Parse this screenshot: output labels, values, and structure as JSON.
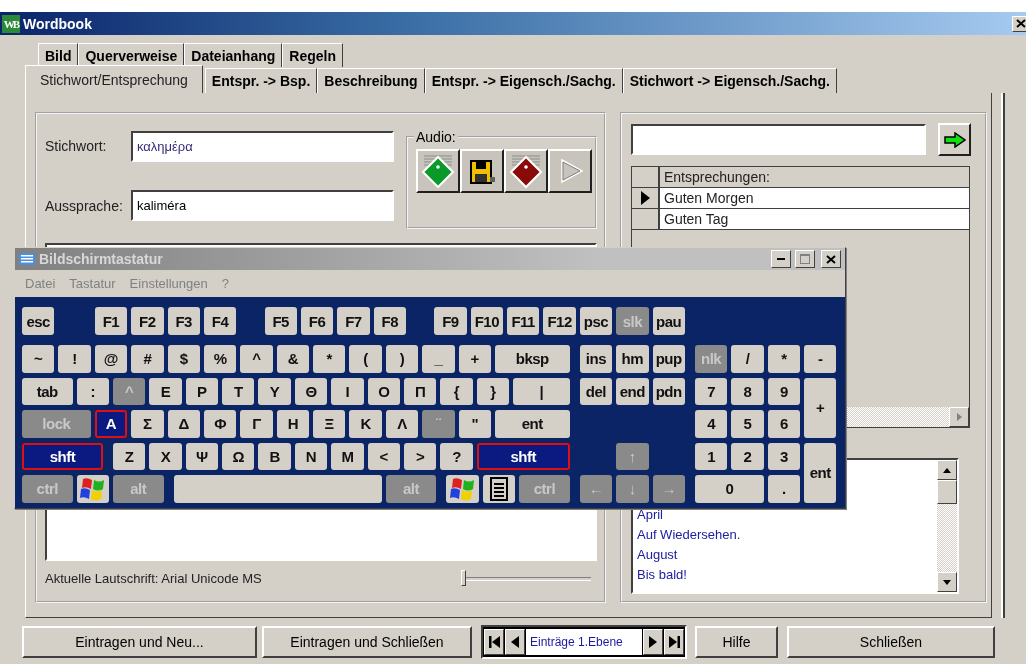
{
  "window": {
    "icon_letters": "WB",
    "title": "Wordbook"
  },
  "tab_rows": [
    [
      {
        "label": "Bild",
        "selected": false
      },
      {
        "label": "Querverweise",
        "selected": false
      },
      {
        "label": "Dateianhang",
        "selected": false
      },
      {
        "label": "Regeln",
        "selected": false
      }
    ],
    [
      {
        "label": "Stichwort/Entsprechung",
        "selected": true
      },
      {
        "label": "Entspr. -> Bsp.",
        "selected": false
      },
      {
        "label": "Beschreibung",
        "selected": false
      },
      {
        "label": "Entspr. -> Eigensch./Sachg.",
        "selected": false
      },
      {
        "label": "Stichwort -> Eigensch./Sachg.",
        "selected": false
      }
    ]
  ],
  "entry": {
    "fields": [
      {
        "label": "Stichwort:",
        "value": "καλημέρα"
      },
      {
        "label": "Aussprache:",
        "value": "kaliméra"
      }
    ],
    "audio": {
      "label": "Audio:",
      "buttons": [
        {
          "kind": "record",
          "disabled": false
        },
        {
          "kind": "save",
          "disabled": false
        },
        {
          "kind": "stop",
          "disabled": false
        },
        {
          "kind": "play",
          "disabled": true
        }
      ]
    },
    "font_label": "Aktuelle Lautschrift: Arial Unicode MS",
    "font_slider": {
      "level": 0
    }
  },
  "translations": {
    "column": "Entsprechungen:",
    "rows": [
      {
        "text": "Guten Morgen",
        "selected": true
      },
      {
        "text": "Guten Tag",
        "selected": false
      }
    ],
    "list": [
      "April",
      "Auf Wiedersehen.",
      "August",
      "Bis bald!"
    ]
  },
  "buttons": [
    "Eintragen und Neu...",
    "Eintragen und Schließen"
  ],
  "navigator": {
    "label": "Einträge 1.Ebene"
  },
  "buttons_right": [
    "Hilfe",
    "Schließen"
  ],
  "keyboard": {
    "title": "Bildschirmtastatur",
    "menu": [
      "Datei",
      "Tastatur",
      "Einstellungen",
      "?"
    ],
    "key_rows": [
      {
        "keys": [
          {
            "kind": "char",
            "label": "esc",
            "disabled": false,
            "pressed": false
          },
          {
            "kind": "char",
            "label": "F1",
            "disabled": false,
            "pressed": false
          },
          {
            "kind": "char",
            "label": "F2",
            "disabled": false,
            "pressed": false
          },
          {
            "kind": "char",
            "label": "F3",
            "disabled": false,
            "pressed": false
          },
          {
            "kind": "char",
            "label": "F4",
            "disabled": false,
            "pressed": false
          },
          {
            "kind": "char",
            "label": "F5",
            "disabled": false,
            "pressed": false
          },
          {
            "kind": "char",
            "label": "F6",
            "disabled": false,
            "pressed": false
          },
          {
            "kind": "char",
            "label": "F7",
            "disabled": false,
            "pressed": false
          },
          {
            "kind": "char",
            "label": "F8",
            "disabled": false,
            "pressed": false
          },
          {
            "kind": "char",
            "label": "F9",
            "disabled": false,
            "pressed": false
          },
          {
            "kind": "char",
            "label": "F10",
            "disabled": false,
            "pressed": false
          },
          {
            "kind": "char",
            "label": "F11",
            "disabled": false,
            "pressed": false
          },
          {
            "kind": "char",
            "label": "F12",
            "disabled": false,
            "pressed": false
          },
          {
            "kind": "char",
            "label": "psc",
            "disabled": false,
            "pressed": false
          },
          {
            "kind": "char",
            "label": "slk",
            "disabled": true,
            "pressed": false
          },
          {
            "kind": "char",
            "label": "pau",
            "disabled": false,
            "pressed": false
          }
        ]
      },
      {
        "keys": [
          {
            "kind": "char",
            "label": "~",
            "disabled": false,
            "pressed": false
          },
          {
            "kind": "char",
            "label": "!",
            "disabled": false,
            "pressed": false
          },
          {
            "kind": "char",
            "label": "@",
            "disabled": false,
            "pressed": false
          },
          {
            "kind": "char",
            "label": "#",
            "disabled": false,
            "pressed": false
          },
          {
            "kind": "char",
            "label": "$",
            "disabled": false,
            "pressed": false
          },
          {
            "kind": "char",
            "label": "%",
            "disabled": false,
            "pressed": false
          },
          {
            "kind": "char",
            "label": "^",
            "disabled": false,
            "pressed": false
          },
          {
            "kind": "char",
            "label": "&",
            "disabled": false,
            "pressed": false
          },
          {
            "kind": "char",
            "label": "*",
            "disabled": false,
            "pressed": false
          },
          {
            "kind": "char",
            "label": "(",
            "disabled": false,
            "pressed": false
          },
          {
            "kind": "char",
            "label": ")",
            "disabled": false,
            "pressed": false
          },
          {
            "kind": "char",
            "label": "_",
            "disabled": false,
            "pressed": false
          },
          {
            "kind": "char",
            "label": "+",
            "disabled": false,
            "pressed": false
          },
          {
            "kind": "char",
            "label": "bksp",
            "disabled": false,
            "pressed": false
          },
          {
            "kind": "char",
            "label": "ins",
            "disabled": false,
            "pressed": false
          },
          {
            "kind": "char",
            "label": "hm",
            "disabled": false,
            "pressed": false
          },
          {
            "kind": "char",
            "label": "pup",
            "disabled": false,
            "pressed": false
          },
          {
            "kind": "char",
            "label": "nlk",
            "disabled": true,
            "pressed": false
          },
          {
            "kind": "char",
            "label": "/",
            "disabled": false,
            "pressed": false
          },
          {
            "kind": "char",
            "label": "*",
            "disabled": false,
            "pressed": false
          },
          {
            "kind": "char",
            "label": "-",
            "disabled": false,
            "pressed": false
          }
        ]
      },
      {
        "keys": [
          {
            "kind": "char",
            "label": "tab",
            "disabled": false,
            "pressed": false
          },
          {
            "kind": "char",
            "label": ":",
            "disabled": false,
            "pressed": false
          },
          {
            "kind": "char",
            "label": "^",
            "disabled": true,
            "pressed": false
          },
          {
            "kind": "char",
            "label": "Ε",
            "disabled": false,
            "pressed": false
          },
          {
            "kind": "char",
            "label": "Ρ",
            "disabled": false,
            "pressed": false
          },
          {
            "kind": "char",
            "label": "Τ",
            "disabled": false,
            "pressed": false
          },
          {
            "kind": "char",
            "label": "Υ",
            "disabled": false,
            "pressed": false
          },
          {
            "kind": "char",
            "label": "Θ",
            "disabled": false,
            "pressed": false
          },
          {
            "kind": "char",
            "label": "Ι",
            "disabled": false,
            "pressed": false
          },
          {
            "kind": "char",
            "label": "Ο",
            "disabled": false,
            "pressed": false
          },
          {
            "kind": "char",
            "label": "Π",
            "disabled": false,
            "pressed": false
          },
          {
            "kind": "char",
            "label": "{",
            "disabled": false,
            "pressed": false
          },
          {
            "kind": "char",
            "label": "}",
            "disabled": false,
            "pressed": false
          },
          {
            "kind": "char",
            "label": "|",
            "disabled": false,
            "pressed": false
          },
          {
            "kind": "char",
            "label": "del",
            "disabled": false,
            "pressed": false
          },
          {
            "kind": "char",
            "label": "end",
            "disabled": false,
            "pressed": false
          },
          {
            "kind": "char",
            "label": "pdn",
            "disabled": false,
            "pressed": false
          },
          {
            "kind": "char",
            "label": "7",
            "disabled": false,
            "pressed": false
          },
          {
            "kind": "char",
            "label": "8",
            "disabled": false,
            "pressed": false
          },
          {
            "kind": "char",
            "label": "9",
            "disabled": false,
            "pressed": false
          },
          {
            "kind": "char",
            "label": "+",
            "disabled": false,
            "pressed": false
          }
        ]
      },
      {
        "keys": [
          {
            "kind": "char",
            "label": "lock",
            "disabled": true,
            "pressed": false
          },
          {
            "kind": "char",
            "label": "Α",
            "disabled": false,
            "pressed": true
          },
          {
            "kind": "char",
            "label": "Σ",
            "disabled": false,
            "pressed": false
          },
          {
            "kind": "char",
            "label": "Δ",
            "disabled": false,
            "pressed": false
          },
          {
            "kind": "char",
            "label": "Φ",
            "disabled": false,
            "pressed": false
          },
          {
            "kind": "char",
            "label": "Γ",
            "disabled": false,
            "pressed": false
          },
          {
            "kind": "char",
            "label": "Η",
            "disabled": false,
            "pressed": false
          },
          {
            "kind": "char",
            "label": "Ξ",
            "disabled": false,
            "pressed": false
          },
          {
            "kind": "char",
            "label": "Κ",
            "disabled": false,
            "pressed": false
          },
          {
            "kind": "char",
            "label": "Λ",
            "disabled": false,
            "pressed": false
          },
          {
            "kind": "char",
            "label": "¨",
            "disabled": true,
            "pressed": false
          },
          {
            "kind": "char",
            "label": "\"",
            "disabled": false,
            "pressed": false
          },
          {
            "kind": "char",
            "label": "ent",
            "disabled": false,
            "pressed": false
          },
          {
            "kind": "char",
            "label": "4",
            "disabled": false,
            "pressed": false
          },
          {
            "kind": "char",
            "label": "5",
            "disabled": false,
            "pressed": false
          },
          {
            "kind": "char",
            "label": "6",
            "disabled": false,
            "pressed": false
          }
        ]
      },
      {
        "keys": [
          {
            "kind": "char",
            "label": "shft",
            "disabled": false,
            "pressed": true
          },
          {
            "kind": "char",
            "label": "Ζ",
            "disabled": false,
            "pressed": false
          },
          {
            "kind": "char",
            "label": "Χ",
            "disabled": false,
            "pressed": false
          },
          {
            "kind": "char",
            "label": "Ψ",
            "disabled": false,
            "pressed": false
          },
          {
            "kind": "char",
            "label": "Ω",
            "disabled": false,
            "pressed": false
          },
          {
            "kind": "char",
            "label": "Β",
            "disabled": false,
            "pressed": false
          },
          {
            "kind": "char",
            "label": "Ν",
            "disabled": false,
            "pressed": false
          },
          {
            "kind": "char",
            "label": "Μ",
            "disabled": false,
            "pressed": false
          },
          {
            "kind": "char",
            "label": "<",
            "disabled": false,
            "pressed": false
          },
          {
            "kind": "char",
            "label": ">",
            "disabled": false,
            "pressed": false
          },
          {
            "kind": "char",
            "label": "?",
            "disabled": false,
            "pressed": false
          },
          {
            "kind": "char",
            "label": "shft",
            "disabled": false,
            "pressed": true
          },
          {
            "kind": "char",
            "label": "↑",
            "disabled": true,
            "pressed": false
          },
          {
            "kind": "char",
            "label": "1",
            "disabled": false,
            "pressed": false
          },
          {
            "kind": "char",
            "label": "2",
            "disabled": false,
            "pressed": false
          },
          {
            "kind": "char",
            "label": "3",
            "disabled": false,
            "pressed": false
          },
          {
            "kind": "char",
            "label": "ent",
            "disabled": false,
            "pressed": false
          }
        ]
      },
      {
        "keys": [
          {
            "kind": "char",
            "label": "ctrl",
            "disabled": true,
            "pressed": false
          },
          {
            "kind": "windows",
            "disabled": false,
            "pressed": false
          },
          {
            "kind": "char",
            "label": "alt",
            "disabled": true,
            "pressed": false
          },
          {
            "kind": "space",
            "disabled": false,
            "pressed": false
          },
          {
            "kind": "char",
            "label": "alt",
            "disabled": true,
            "pressed": false
          },
          {
            "kind": "windows",
            "disabled": false,
            "pressed": false
          },
          {
            "kind": "menu",
            "disabled": false,
            "pressed": false
          },
          {
            "kind": "char",
            "label": "ctrl",
            "disabled": true,
            "pressed": false
          },
          {
            "kind": "char",
            "label": "←",
            "disabled": true,
            "pressed": false
          },
          {
            "kind": "char",
            "label": "↓",
            "disabled": true,
            "pressed": false
          },
          {
            "kind": "char",
            "label": "→",
            "disabled": true,
            "pressed": false
          },
          {
            "kind": "char",
            "label": "0",
            "disabled": false,
            "pressed": false
          },
          {
            "kind": "char",
            "label": ".",
            "disabled": false,
            "pressed": false
          }
        ]
      }
    ]
  }
}
